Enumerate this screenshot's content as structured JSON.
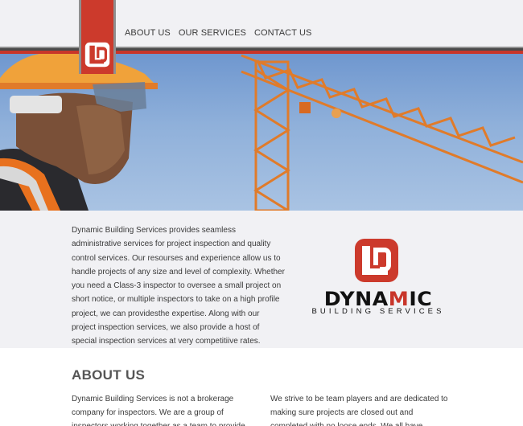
{
  "nav": {
    "items": [
      {
        "label": "ABOUT US"
      },
      {
        "label": "OUR SERVICES"
      },
      {
        "label": "CONTACT US"
      }
    ]
  },
  "intro": {
    "text": "Dynamic Building Services provides seamless administrative services for project inspection and quality control services. Our resourses and experience allow us to handle projects of any size and level of complexity. Whether you need a Class-3 inspector to oversee a small project on short notice, or multiple inspectors to take on a high profile project, we can providesthe expertise. Along with our project inspection services, we also provide a host of special inspection services at very competitiive rates."
  },
  "brand": {
    "word_start": "DYNA",
    "word_mid": "M",
    "word_end": "IC",
    "subtitle": "BUILDING SERVICES"
  },
  "about": {
    "title": "ABOUT US",
    "left_text": "Dynamic Building Services is not a brokerage company for inspectors. We are a group of inspectors working together as a team to provide districts with a",
    "right_text": "We strive to be team players and are dedicated to making sure projects are closed out and completed with no loose ends. We all have excellent working"
  },
  "colors": {
    "brand_red": "#cc3a2c",
    "header_bg": "#f1f1f4",
    "sky": "#8fb0da",
    "crane": "#e07b2a"
  }
}
